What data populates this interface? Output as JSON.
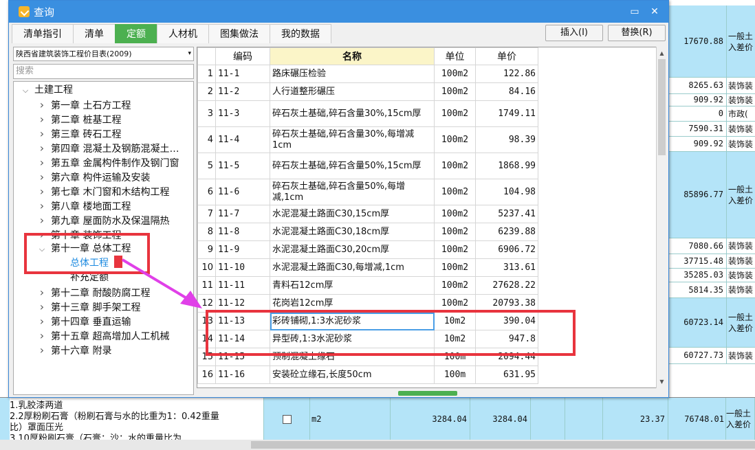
{
  "background_rows": [
    {
      "value": "17670.88",
      "text": "一般土\n入差价",
      "two": true,
      "hl": true
    },
    {
      "value": "8265.63",
      "text": "装饰装"
    },
    {
      "value": "909.92",
      "text": "装饰装"
    },
    {
      "value": "0",
      "text": "市政("
    },
    {
      "value": "7590.31",
      "text": "装饰装"
    },
    {
      "value": "909.92",
      "text": "装饰装"
    },
    {
      "value": "85896.77",
      "text": "一般土\n入差价",
      "two": true,
      "hl": true
    },
    {
      "value": "7080.66",
      "text": "装饰装"
    },
    {
      "value": "37715.48",
      "text": "装饰装"
    },
    {
      "value": "35285.03",
      "text": "装饰装"
    },
    {
      "value": "5814.35",
      "text": "装饰装"
    },
    {
      "value": "60723.14",
      "text": "一般土\n入差价",
      "two": true,
      "hl": true
    },
    {
      "value": "60727.73",
      "text": "装饰装"
    }
  ],
  "background_bottom": {
    "desc_lines": [
      "1.乳胶漆两道",
      "2.2厚粉刷石膏（粉刷石膏与水的比重为1：0.42重量",
      "比）罩面压光",
      "3.10厚粉刷石膏（石膏：沙：水的重量比为"
    ],
    "unit": "m2",
    "qty1": "3284.04",
    "qty2": "3284.04",
    "price": "23.37",
    "total": "76748.01",
    "type": "一般土\n入差价"
  },
  "dialog": {
    "title": "查询",
    "tabs": [
      "清单指引",
      "清单",
      "定额",
      "人材机",
      "图集做法",
      "我的数据"
    ],
    "active_tab": 2,
    "insert_label": "插入(I)",
    "replace_label": "替换(R)",
    "library_select": "陕西省建筑装饰工程价目表(2009)",
    "search_placeholder": "搜索"
  },
  "tree": [
    {
      "label": "土建工程",
      "level": 0,
      "arrow": "down"
    },
    {
      "label": "第一章  土石方工程",
      "level": 1,
      "arrow": "right"
    },
    {
      "label": "第二章  桩基工程",
      "level": 1,
      "arrow": "right"
    },
    {
      "label": "第三章  砖石工程",
      "level": 1,
      "arrow": "right"
    },
    {
      "label": "第四章  混凝土及钢筋混凝土…",
      "level": 1,
      "arrow": "right"
    },
    {
      "label": "第五章  金属构件制作及钢门窗",
      "level": 1,
      "arrow": "right"
    },
    {
      "label": "第六章  构件运输及安装",
      "level": 1,
      "arrow": "right"
    },
    {
      "label": "第七章  木门窗和木结构工程",
      "level": 1,
      "arrow": "right"
    },
    {
      "label": "第八章  楼地面工程",
      "level": 1,
      "arrow": "right"
    },
    {
      "label": "第九章  屋面防水及保温隔热",
      "level": 1,
      "arrow": "right"
    },
    {
      "label": "第十章  装饰工程",
      "level": 1,
      "arrow": "right"
    },
    {
      "label": "第十一章  总体工程",
      "level": 1,
      "arrow": "down"
    },
    {
      "label": "总体工程",
      "level": 2,
      "arrow": "",
      "selected": true
    },
    {
      "label": "补充定额",
      "level": 2,
      "arrow": ""
    },
    {
      "label": "第十二章  耐酸防腐工程",
      "level": 1,
      "arrow": "right"
    },
    {
      "label": "第十三章  脚手架工程",
      "level": 1,
      "arrow": "right"
    },
    {
      "label": "第十四章  垂直运输",
      "level": 1,
      "arrow": "right"
    },
    {
      "label": "第十五章  超高增加人工机械",
      "level": 1,
      "arrow": "right"
    },
    {
      "label": "第十六章  附录",
      "level": 1,
      "arrow": "right"
    }
  ],
  "grid": {
    "headers": [
      "",
      "编码",
      "名称",
      "单位",
      "单价"
    ],
    "rows": [
      {
        "idx": "1",
        "code": "11-1",
        "name": "路床碾压检验",
        "unit": "100m2",
        "price": "122.86"
      },
      {
        "idx": "2",
        "code": "11-2",
        "name": "人行道整形碾压",
        "unit": "100m2",
        "price": "84.16"
      },
      {
        "idx": "3",
        "code": "11-3",
        "name": "碎石灰土基础,碎石含量30%,15cm厚",
        "unit": "100m2",
        "price": "1749.11",
        "tall": true
      },
      {
        "idx": "4",
        "code": "11-4",
        "name": "碎石灰土基础,碎石含量30%,每增减1cm",
        "unit": "100m2",
        "price": "98.39",
        "tall": true
      },
      {
        "idx": "5",
        "code": "11-5",
        "name": "碎石灰土基础,碎石含量50%,15cm厚",
        "unit": "100m2",
        "price": "1868.99",
        "tall": true
      },
      {
        "idx": "6",
        "code": "11-6",
        "name": "碎石灰土基础,碎石含量50%,每增减,1cm",
        "unit": "100m2",
        "price": "104.98",
        "tall": true
      },
      {
        "idx": "7",
        "code": "11-7",
        "name": "水泥混凝土路面C30,15cm厚",
        "unit": "100m2",
        "price": "5237.41"
      },
      {
        "idx": "8",
        "code": "11-8",
        "name": "水泥混凝土路面C30,18cm厚",
        "unit": "100m2",
        "price": "6239.88"
      },
      {
        "idx": "9",
        "code": "11-9",
        "name": "水泥混凝土路面C30,20cm厚",
        "unit": "100m2",
        "price": "6906.72"
      },
      {
        "idx": "10",
        "code": "11-10",
        "name": "水泥混凝土路面C30,每增减,1cm",
        "unit": "100m2",
        "price": "313.61"
      },
      {
        "idx": "11",
        "code": "11-11",
        "name": "青料石12cm厚",
        "unit": "100m2",
        "price": "27628.22"
      },
      {
        "idx": "12",
        "code": "11-12",
        "name": "花岗岩12cm厚",
        "unit": "100m2",
        "price": "20793.38"
      },
      {
        "idx": "13",
        "code": "11-13",
        "name": "彩砖铺砌,1:3水泥砂浆",
        "unit": "10m2",
        "price": "390.04",
        "selected": true
      },
      {
        "idx": "14",
        "code": "11-14",
        "name": "异型砖,1:3水泥砂浆",
        "unit": "10m2",
        "price": "947.8"
      },
      {
        "idx": "15",
        "code": "11-15",
        "name": "预制混凝土缘石",
        "unit": "100m",
        "price": "2094.44"
      },
      {
        "idx": "16",
        "code": "11-16",
        "name": "安装砼立缘石,长度50cm",
        "unit": "100m",
        "price": "631.95"
      }
    ]
  },
  "colors": {
    "accent_green": "#4cb050",
    "title_blue": "#3a8fe0",
    "annotation_red": "#e8343e",
    "annotation_arrow": "#e040e8"
  }
}
